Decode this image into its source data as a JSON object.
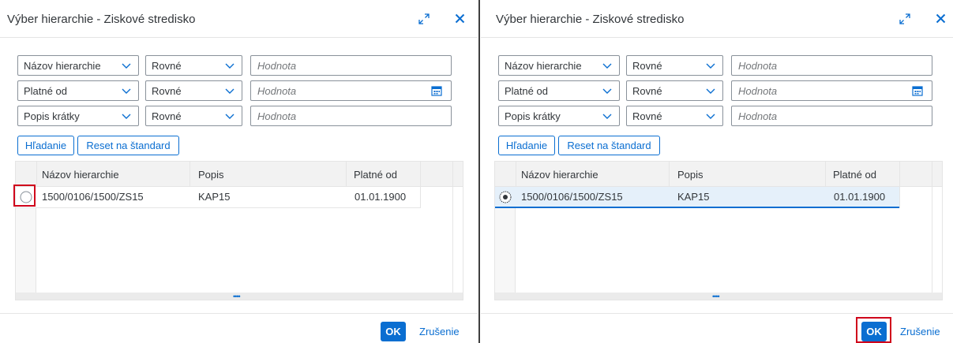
{
  "dialogs": [
    {
      "title": "Výber hierarchie - Ziskové stredisko",
      "filters": [
        {
          "field": "Názov hierarchie",
          "operator": "Rovné",
          "placeholder": "Hodnota"
        },
        {
          "field": "Platné od",
          "operator": "Rovné",
          "placeholder": "Hodnota"
        },
        {
          "field": "Popis krátky",
          "operator": "Rovné",
          "placeholder": "Hodnota"
        }
      ],
      "search_label": "Hľadanie",
      "reset_label": "Reset na štandard",
      "columns": [
        "Názov hierarchie",
        "Popis",
        "Platné od"
      ],
      "rows": [
        {
          "name": "1500/0106/1500/ZS15",
          "popis": "KAP15",
          "platne_od": "01.01.1900",
          "selected": false
        }
      ],
      "ok_label": "OK",
      "cancel_label": "Zrušenie"
    },
    {
      "title": "Výber hierarchie - Ziskové stredisko",
      "filters": [
        {
          "field": "Názov hierarchie",
          "operator": "Rovné",
          "placeholder": "Hodnota"
        },
        {
          "field": "Platné od",
          "operator": "Rovné",
          "placeholder": "Hodnota"
        },
        {
          "field": "Popis krátky",
          "operator": "Rovné",
          "placeholder": "Hodnota"
        }
      ],
      "search_label": "Hľadanie",
      "reset_label": "Reset na štandard",
      "columns": [
        "Názov hierarchie",
        "Popis",
        "Platné od"
      ],
      "rows": [
        {
          "name": "1500/0106/1500/ZS15",
          "popis": "KAP15",
          "platne_od": "01.01.1900",
          "selected": true
        }
      ],
      "ok_label": "OK",
      "cancel_label": "Zrušenie"
    }
  ],
  "icons": {
    "resize": "resize-icon",
    "close": "close-icon",
    "dropdown": "chevron-down-icon",
    "calendar": "calendar-icon",
    "radio": "radio-icon"
  },
  "colors": {
    "accent": "#0a6ed1",
    "highlight": "#d0021b",
    "selected_row": "#e5f0fa",
    "header_bg": "#f2f2f2"
  }
}
